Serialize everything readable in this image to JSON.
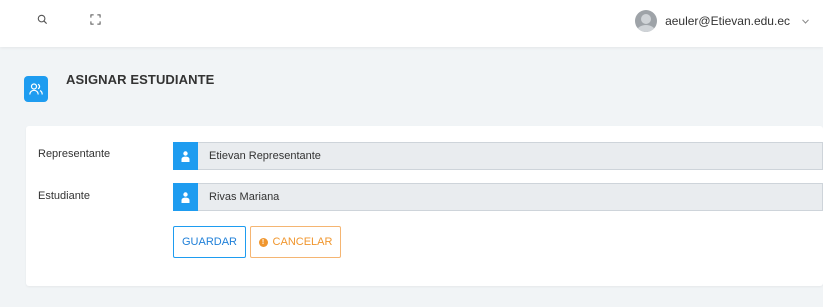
{
  "topbar": {
    "user_email": "aeuler@Etievan.edu.ec",
    "icons": [
      "search-icon",
      "expand-icon",
      "avatar",
      "chevron-down-icon"
    ]
  },
  "header": {
    "title": "ASIGNAR ESTUDIANTE",
    "icon": "users-icon"
  },
  "form": {
    "representante": {
      "label": "Representante",
      "value": "Etievan Representante",
      "icon": "user-icon"
    },
    "estudiante": {
      "label": "Estudiante",
      "value": "Rivas Mariana",
      "icon": "user-icon"
    }
  },
  "actions": {
    "save_label": "GUARDAR",
    "cancel_label": "CANCELAR"
  },
  "colors": {
    "accent": "#1e9cf0",
    "warning": "#f0962e",
    "background": "#f1f4f6"
  }
}
